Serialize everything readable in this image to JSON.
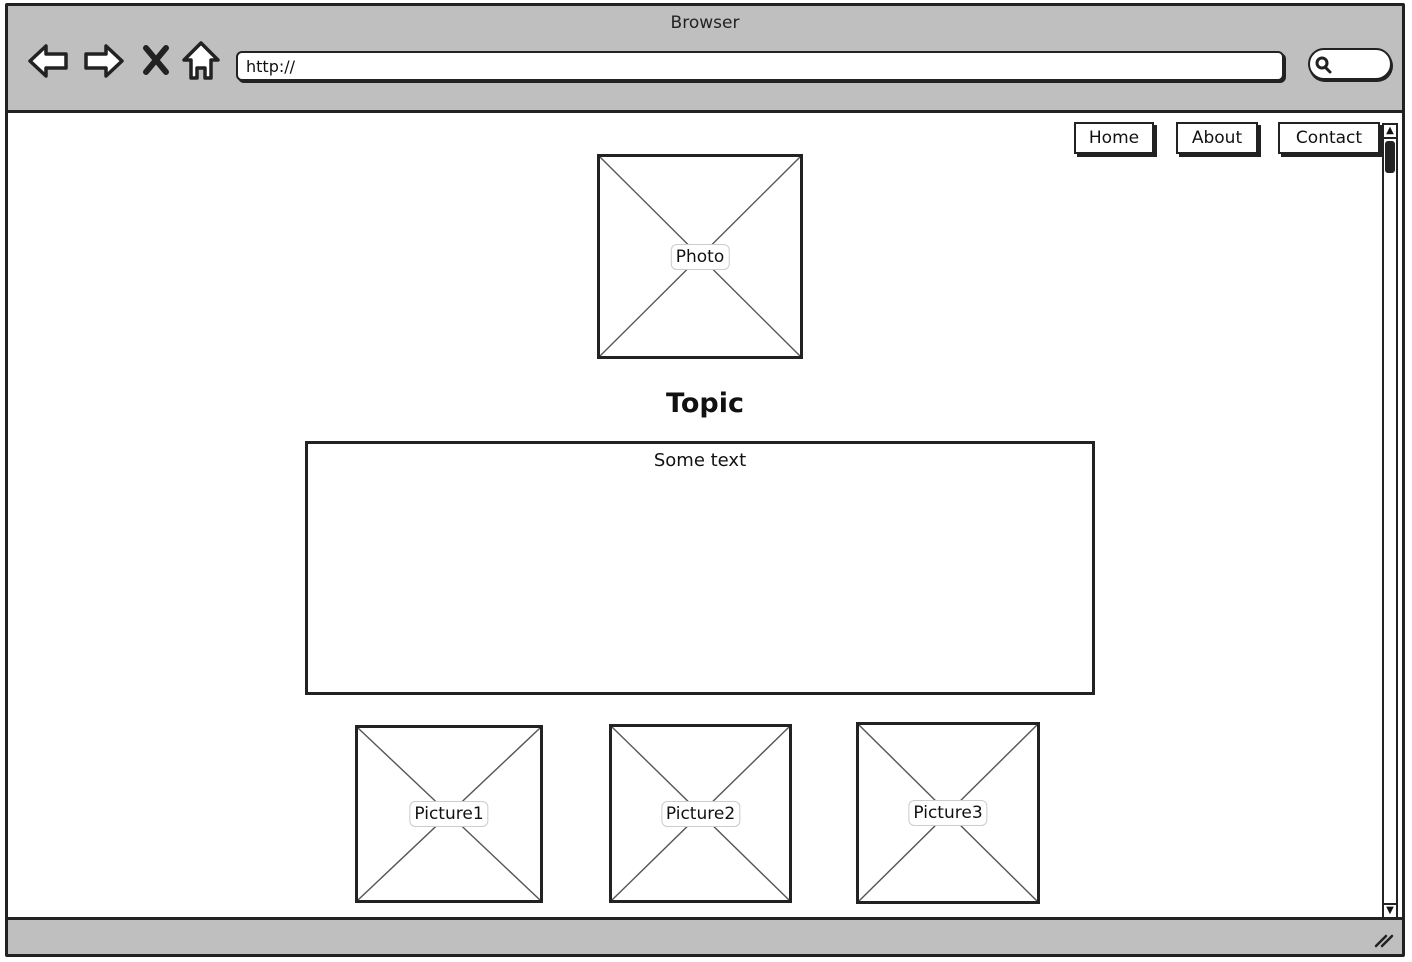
{
  "window": {
    "title": "Browser"
  },
  "toolbar": {
    "back_icon": "back-arrow-icon",
    "forward_icon": "forward-arrow-icon",
    "stop_icon": "close-icon",
    "home_icon": "home-icon",
    "url": "http://",
    "search_icon": "search-icon"
  },
  "nav": {
    "items": [
      {
        "label": "Home"
      },
      {
        "label": "About"
      },
      {
        "label": "Contact"
      }
    ]
  },
  "main": {
    "photo_label": "Photo",
    "topic": "Topic",
    "body_text": "Some text",
    "pictures": [
      {
        "label": "Picture1"
      },
      {
        "label": "Picture2"
      },
      {
        "label": "Picture3"
      }
    ]
  },
  "colors": {
    "chrome": "#bfbfbf",
    "stroke": "#222222",
    "placeholder_cross": "#555555"
  }
}
